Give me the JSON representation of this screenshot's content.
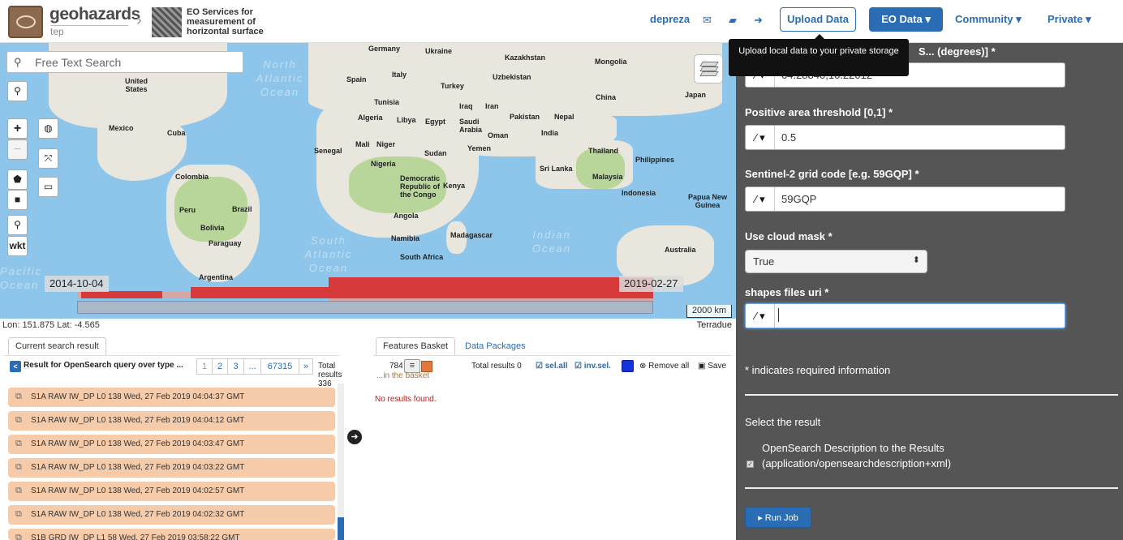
{
  "header": {
    "logo_title": "geohazards",
    "logo_sub": "tep",
    "service_title": "EO Services for measurement of horizontal surface",
    "user": "depreza",
    "icons": [
      "envelope-icon",
      "book-icon",
      "sign-out-icon"
    ],
    "upload_label": "Upload Data",
    "eo_data_label": "EO Data ▾",
    "community_label": "Community ▾",
    "private_label": "Private ▾",
    "tooltip": "Upload local data to your private storage"
  },
  "map": {
    "search_placeholder": "Free Text Search",
    "tools": {
      "search": "search-icon",
      "zoom_in": "+",
      "zoom_out": "−",
      "wkt": "wkt"
    },
    "oceans": {
      "north_atlantic": "North Atlantic Ocean",
      "south_atlantic": "South Atlantic Ocean",
      "indian": "Indian Ocean",
      "pacific": "Pacific Ocean"
    },
    "labels": {
      "germany": "Germany",
      "ukraine": "Ukraine",
      "kazakhstan": "Kazakhstan",
      "mongolia": "Mongolia",
      "united_states": "United States",
      "spain": "Spain",
      "italy": "Italy",
      "turkey": "Turkey",
      "uzbekistan": "Uzbekistan",
      "china": "China",
      "japan": "Japan",
      "tunisia": "Tunisia",
      "iraq": "Iraq",
      "iran": "Iran",
      "mexico": "Mexico",
      "cuba": "Cuba",
      "algeria": "Algeria",
      "libya": "Libya",
      "egypt": "Egypt",
      "saudi_arabia": "Saudi Arabia",
      "pakistan": "Pakistan",
      "nepal": "Nepal",
      "india": "India",
      "oman": "Oman",
      "mali": "Mali",
      "niger": "Niger",
      "senegal": "Senegal",
      "sudan": "Sudan",
      "yemen": "Yemen",
      "thailand": "Thailand",
      "philippines": "Philippines",
      "nigeria": "Nigeria",
      "sri_lanka": "Sri Lanka",
      "malaysia": "Malaysia",
      "colombia": "Colombia",
      "drc": "Democratic Republic of the Congo",
      "kenya": "Kenya",
      "indonesia": "Indonesia",
      "papua": "Papua New Guinea",
      "peru": "Peru",
      "brazil": "Brazil",
      "angola": "Angola",
      "bolivia": "Bolivia",
      "paraguay": "Paraguay",
      "namibia": "Namibia",
      "madagascar": "Madagascar",
      "australia": "Australia",
      "south_africa": "South Africa",
      "argentina": "Argentina"
    },
    "date_start": "2014-10-04",
    "date_end": "2019-02-27",
    "scale": "2000 km",
    "coords": "Lon: 151.875 Lat: -4.565",
    "attribution": "Terradue"
  },
  "form": {
    "field1_label": "S... (degrees)] *",
    "field1_value": "64.28840,10.22012",
    "field2_label": "Positive area threshold [0,1] *",
    "field2_value": "0.5",
    "field3_label": "Sentinel-2 grid code [e.g. 59GQP] *",
    "field3_value": "59GQP",
    "field4_label": "Use cloud mask *",
    "field4_value": "True",
    "field5_label": "shapes files uri *",
    "field5_value": "",
    "required_note": "* indicates required information",
    "select_result": "Select the result",
    "result_option": "OpenSearch Description to the Results (application/opensearchdescription+xml)",
    "run_label": "Run Job"
  },
  "results": {
    "tab_label": "Current search result",
    "query_label": "Result for OpenSearch query over type ...",
    "pages": [
      "1",
      "2",
      "3",
      "...",
      "67315",
      "»"
    ],
    "total": "Total results 336",
    "items": [
      "S1A RAW IW_DP L0 138 Wed, 27 Feb 2019 04:04:37 GMT",
      "S1A RAW IW_DP L0 138 Wed, 27 Feb 2019 04:04:12 GMT",
      "S1A RAW IW_DP L0 138 Wed, 27 Feb 2019 04:03:47 GMT",
      "S1A RAW IW_DP L0 138 Wed, 27 Feb 2019 04:03:22 GMT",
      "S1A RAW IW_DP L0 138 Wed, 27 Feb 2019 04:02:57 GMT",
      "S1A RAW IW_DP L0 138 Wed, 27 Feb 2019 04:02:32 GMT",
      "S1B GRD IW_DP L1 58 Wed, 27 Feb 2019 03:58:22 GMT"
    ]
  },
  "basket": {
    "tab1": "Features Basket",
    "tab2": "Data Packages",
    "count_overlap": "784",
    "move_text": "...in the basket",
    "total": "Total results 0",
    "sel_all": "sel.all",
    "inv_sel": "inv.sel.",
    "remove_all": "Remove all",
    "save": "Save",
    "empty": "No results found."
  }
}
